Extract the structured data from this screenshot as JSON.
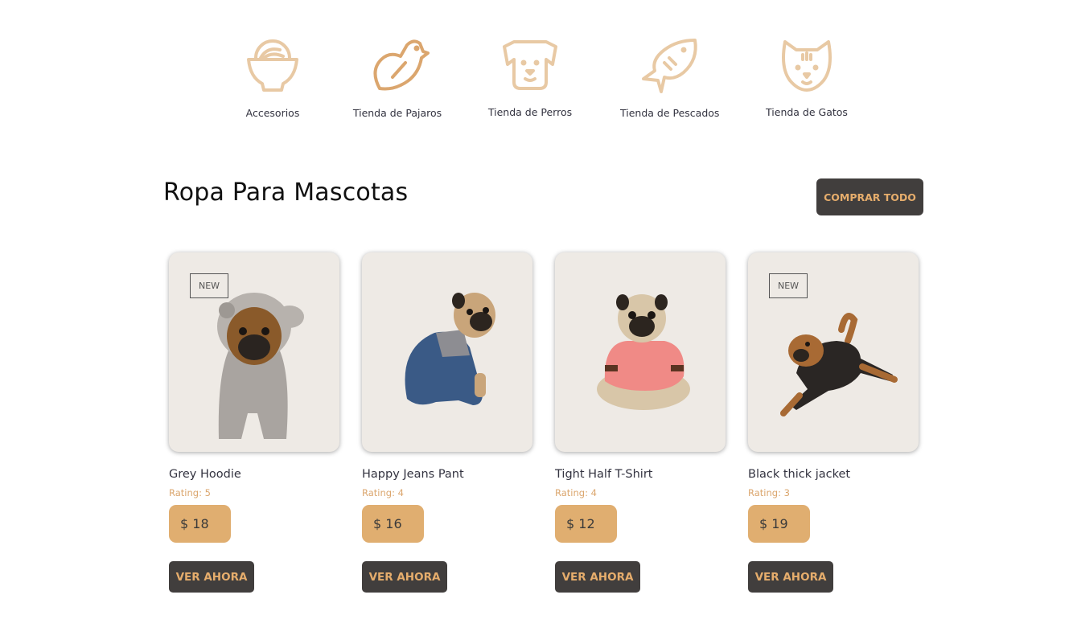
{
  "colors": {
    "accent": "#e0ae70",
    "icon_stroke": "#e8c9a4",
    "dark_button": "#413e3d",
    "button_text": "#e6ad6c",
    "card_bg": "#eeeae5",
    "rating_text": "#dba66e"
  },
  "categories": [
    {
      "label": "Accesorios",
      "icon": "bowl-icon"
    },
    {
      "label": "Tienda de Pajaros",
      "icon": "bird-icon"
    },
    {
      "label": "Tienda de Perros",
      "icon": "dog-icon"
    },
    {
      "label": "Tienda de Pescados",
      "icon": "fish-icon"
    },
    {
      "label": "Tienda de Gatos",
      "icon": "cat-icon"
    }
  ],
  "section": {
    "title": "Ropa Para Mascotas",
    "shop_all_label": "COMPRAR TODO"
  },
  "products": [
    {
      "name": "Grey Hoodie",
      "rating": "Rating: 5",
      "price": "$ 18",
      "badge": "NEW",
      "button": "VER AHORA",
      "image": "pug-grey-hoodie"
    },
    {
      "name": "Happy Jeans Pant",
      "rating": "Rating: 4",
      "price": "$ 16",
      "badge": "",
      "button": "VER AHORA",
      "image": "pug-jeans-overall"
    },
    {
      "name": "Tight Half T-Shirt",
      "rating": "Rating: 4",
      "price": "$ 12",
      "badge": "",
      "button": "VER AHORA",
      "image": "pug-pink-shirt"
    },
    {
      "name": "Black thick jacket",
      "rating": "Rating: 3",
      "price": "$ 19",
      "badge": "NEW",
      "button": "VER AHORA",
      "image": "dog-black-jacket"
    }
  ]
}
